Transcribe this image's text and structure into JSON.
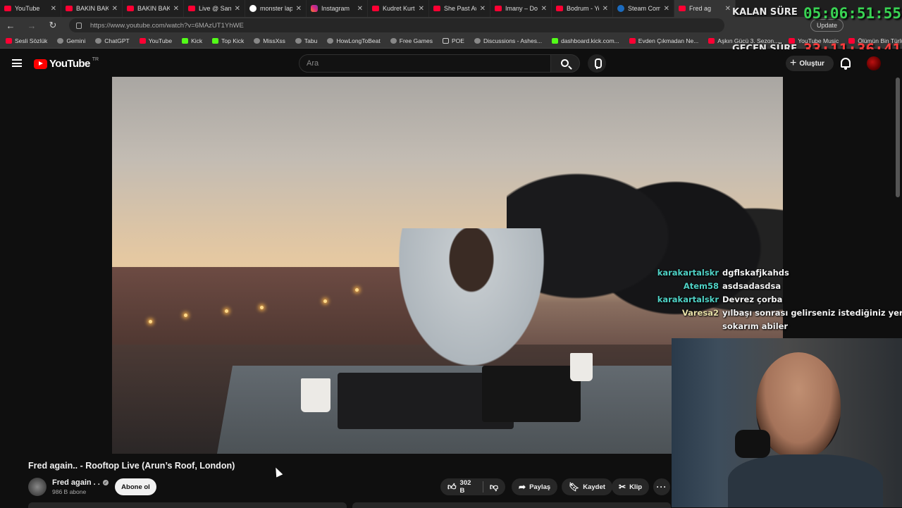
{
  "browser": {
    "tabs": [
      {
        "label": "YouTube",
        "icon": "youtube-icon"
      },
      {
        "label": "BAKIN BAKIN",
        "icon": "youtube-icon"
      },
      {
        "label": "BAKIN BAKIN",
        "icon": "youtube-icon"
      },
      {
        "label": "Live @ Santa",
        "icon": "youtube-icon"
      },
      {
        "label": "monster lapt",
        "icon": "google-icon"
      },
      {
        "label": "Instagram",
        "icon": "instagram-icon"
      },
      {
        "label": "Kudret Kurto",
        "icon": "youtube-icon"
      },
      {
        "label": "She Past Awa",
        "icon": "youtube-icon"
      },
      {
        "label": "Imany – Don",
        "icon": "youtube-icon"
      },
      {
        "label": "Bodrum - Yo",
        "icon": "youtube-icon"
      },
      {
        "label": "Steam Comm",
        "icon": "steam-icon"
      },
      {
        "label": "Fred ag",
        "icon": "youtube-icon"
      }
    ],
    "url": "https://www.youtube.com/watch?v=6MAzUT1YhWE",
    "update_label": "Update",
    "bookmarks": [
      {
        "label": "Sesli Sözlük",
        "icon": "youtube-icon"
      },
      {
        "label": "Gemini",
        "icon": "gemini-icon"
      },
      {
        "label": "ChatGPT",
        "icon": "chatgpt-icon"
      },
      {
        "label": "YouTube",
        "icon": "youtube-icon"
      },
      {
        "label": "Kick",
        "icon": "kick-icon"
      },
      {
        "label": "Top Kick",
        "icon": "kick-icon"
      },
      {
        "label": "MissXss",
        "icon": "globe-icon"
      },
      {
        "label": "Tabu",
        "icon": "globe-icon"
      },
      {
        "label": "HowLongToBeat",
        "icon": "globe-icon"
      },
      {
        "label": "Free Games",
        "icon": "tag-icon"
      },
      {
        "label": "POE",
        "icon": "folder-icon"
      },
      {
        "label": "Discussions - Ashes...",
        "icon": "globe-icon"
      },
      {
        "label": "dashboard.kick.com...",
        "icon": "kick-icon"
      },
      {
        "label": "Evden Çıkmadan Ne...",
        "icon": "youtube-icon"
      },
      {
        "label": "Aşkın Gücü 3. Sezon...",
        "icon": "youtube-icon"
      },
      {
        "label": "YouTube Music",
        "icon": "youtube-icon"
      },
      {
        "label": "Ölümün Bin Türlü H...",
        "icon": "youtube-icon"
      }
    ]
  },
  "overlay": {
    "remaining_label": "KALAN SÜRE",
    "remaining_time": "05:06:51:55",
    "remaining_color": "#39d353",
    "elapsed_label": "GEÇEN SÜRE",
    "elapsed_time": "33:11:36:41",
    "elapsed_color": "#ff3b3b"
  },
  "header": {
    "logo_text": "YouTube",
    "logo_region": "TR",
    "search_placeholder": "Ara",
    "create_label": "Oluştur"
  },
  "chat": [
    {
      "user": "karakartalskr",
      "color": "#4fd1c5",
      "message": "dgflskafjkahds"
    },
    {
      "user": "Atem58",
      "color": "#4fd1c5",
      "message": "asdsadasdsa"
    },
    {
      "user": "karakartalskr",
      "color": "#4fd1c5",
      "message": "Devrez çorba"
    },
    {
      "user": "Varesa2",
      "color": "#e8e0a8",
      "message": "yılbaşı sonrası gelirseniz istediğiniz yere"
    },
    {
      "user": "",
      "color": "#ffffff",
      "message": "sokarım abiler"
    }
  ],
  "video": {
    "title": "Fred again.. - Rooftop Live (Arun’s Roof, London)",
    "channel_name": "Fred again . .",
    "subscribers": "986 B abone",
    "subscribe_label": "Abone ol",
    "like_count": "302 B",
    "share_label": "Paylaş",
    "save_label": "Kaydet",
    "clip_label": "Klip"
  }
}
